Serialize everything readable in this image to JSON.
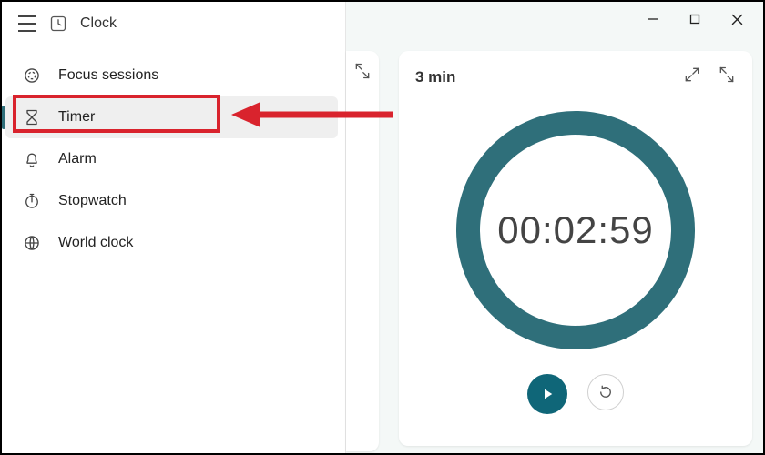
{
  "app": {
    "title": "Clock"
  },
  "nav": {
    "items": [
      {
        "label": "Focus sessions"
      },
      {
        "label": "Timer"
      },
      {
        "label": "Alarm"
      },
      {
        "label": "Stopwatch"
      },
      {
        "label": "World clock"
      }
    ],
    "active_index": 1
  },
  "timer_card": {
    "title": "3 min",
    "time_display": "00:02:59"
  },
  "colors": {
    "accent": "#2f6f7a",
    "ring": "#2f6f7a",
    "highlight": "#d9232d"
  },
  "annotation": {
    "highlight_nav_index": 1
  }
}
